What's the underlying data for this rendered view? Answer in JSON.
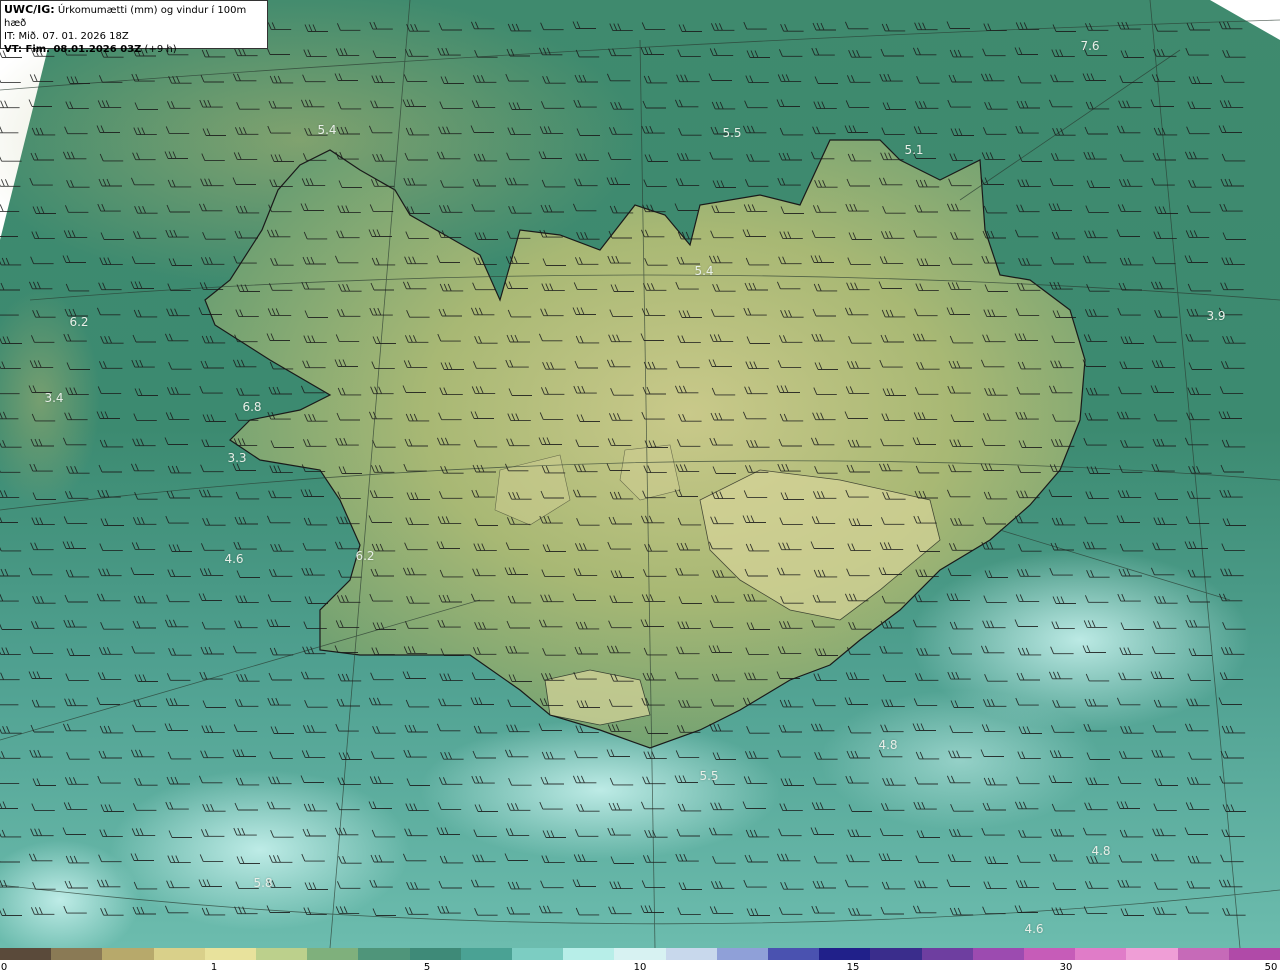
{
  "header": {
    "title_bold": "UWC/IG:",
    "title_rest": " Úrkomumætti (mm) og vindur í 100m hæð",
    "init_time": "IT: Mið. 07. 01. 2026 18Z",
    "valid_bold": "VT: Fim. 08.01.2026 03Z",
    "valid_rest": " (+9 h)"
  },
  "map_labels": [
    {
      "text": "7.6",
      "faint": false
    },
    {
      "text": "5.4",
      "faint": false
    },
    {
      "text": "5.5",
      "faint": false
    },
    {
      "text": "5.1",
      "faint": false
    },
    {
      "text": "5.4",
      "faint": false
    },
    {
      "text": "6.2",
      "faint": false
    },
    {
      "text": "3.9",
      "faint": false
    },
    {
      "text": "3.4",
      "faint": false
    },
    {
      "text": "6.8",
      "faint": false
    },
    {
      "text": "3.3",
      "faint": false
    },
    {
      "text": "4.6",
      "faint": false
    },
    {
      "text": "6.2",
      "faint": false
    },
    {
      "text": "4.8",
      "faint": false
    },
    {
      "text": "5.5",
      "faint": false
    },
    {
      "text": "5.8",
      "faint": false
    },
    {
      "text": "4.8",
      "faint": false
    },
    {
      "text": "4.6",
      "faint": false
    }
  ],
  "colorbar": {
    "ticks": [
      "0",
      "1",
      "5",
      "10",
      "15",
      "30",
      "50"
    ],
    "colors": [
      "#5a4a3a",
      "#8a7a55",
      "#b7a96b",
      "#d9d08a",
      "#e8e29c",
      "#bcd08c",
      "#7fb07c",
      "#4f957a",
      "#3e8a78",
      "#4aa294",
      "#7ccdc2",
      "#b7eee8",
      "#d7f2f2",
      "#c8d8ec",
      "#8fa0d8",
      "#4a52b0",
      "#20208a",
      "#3a2d8c",
      "#6e3ea0",
      "#9c4bb0",
      "#c65cb8",
      "#e07cc8",
      "#ef9ed6",
      "#c66ab8",
      "#b04aa8"
    ]
  }
}
